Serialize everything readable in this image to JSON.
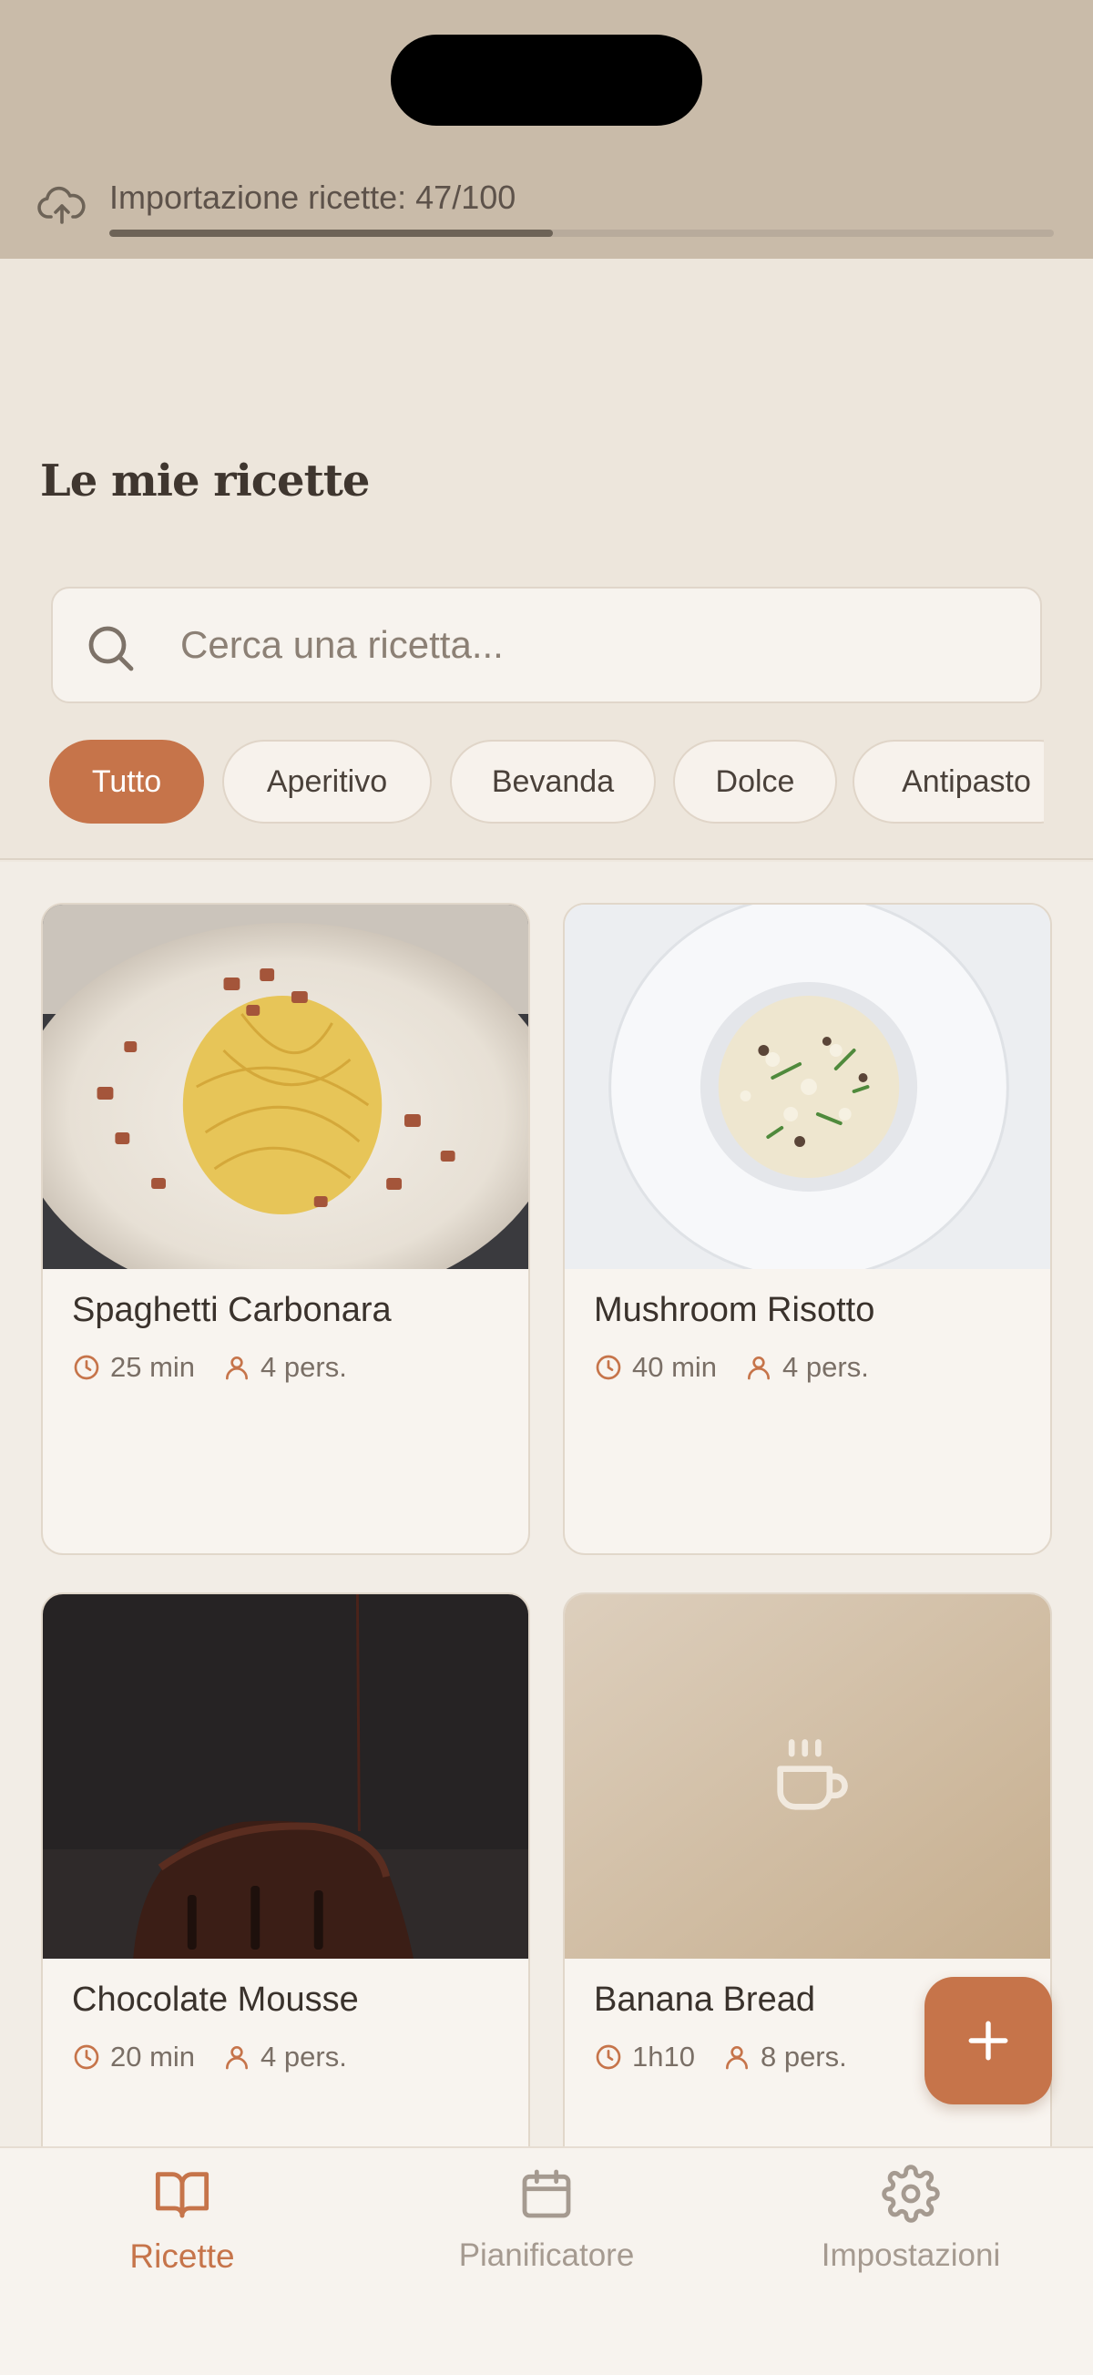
{
  "import_banner": {
    "label": "Importazione ricette: 47/100",
    "progress_fraction": 0.47,
    "icon": "cloud-upload-icon"
  },
  "header": {
    "title": "Le mie ricette"
  },
  "search": {
    "placeholder": "Cerca una ricetta...",
    "value": "",
    "icon": "search-icon"
  },
  "filters": {
    "selected": "Tutto",
    "items": [
      "Tutto",
      "Aperitivo",
      "Bevanda",
      "Dolce",
      "Antipasto"
    ]
  },
  "recipes": [
    {
      "title": "Spaghetti Carbonara",
      "time": "25 min",
      "servings": "4 pers."
    },
    {
      "title": "Mushroom Risotto",
      "time": "40 min",
      "servings": "4 pers."
    },
    {
      "title": "Chocolate Mousse",
      "time": "20 min",
      "servings": "4 pers."
    },
    {
      "title": "Banana Bread",
      "time": "1h10",
      "servings": "8 pers.",
      "placeholder_icon": "coffee-cup-icon"
    }
  ],
  "fab": {
    "icon": "plus-icon"
  },
  "nav": {
    "active": "Ricette",
    "items": [
      {
        "label": "Ricette",
        "icon": "book-open-icon"
      },
      {
        "label": "Pianificatore",
        "icon": "calendar-icon"
      },
      {
        "label": "Impostazioni",
        "icon": "gear-icon"
      }
    ]
  },
  "colors": {
    "accent": "#c6744a",
    "banner": "#c9bba9",
    "background": "#efe8df"
  }
}
